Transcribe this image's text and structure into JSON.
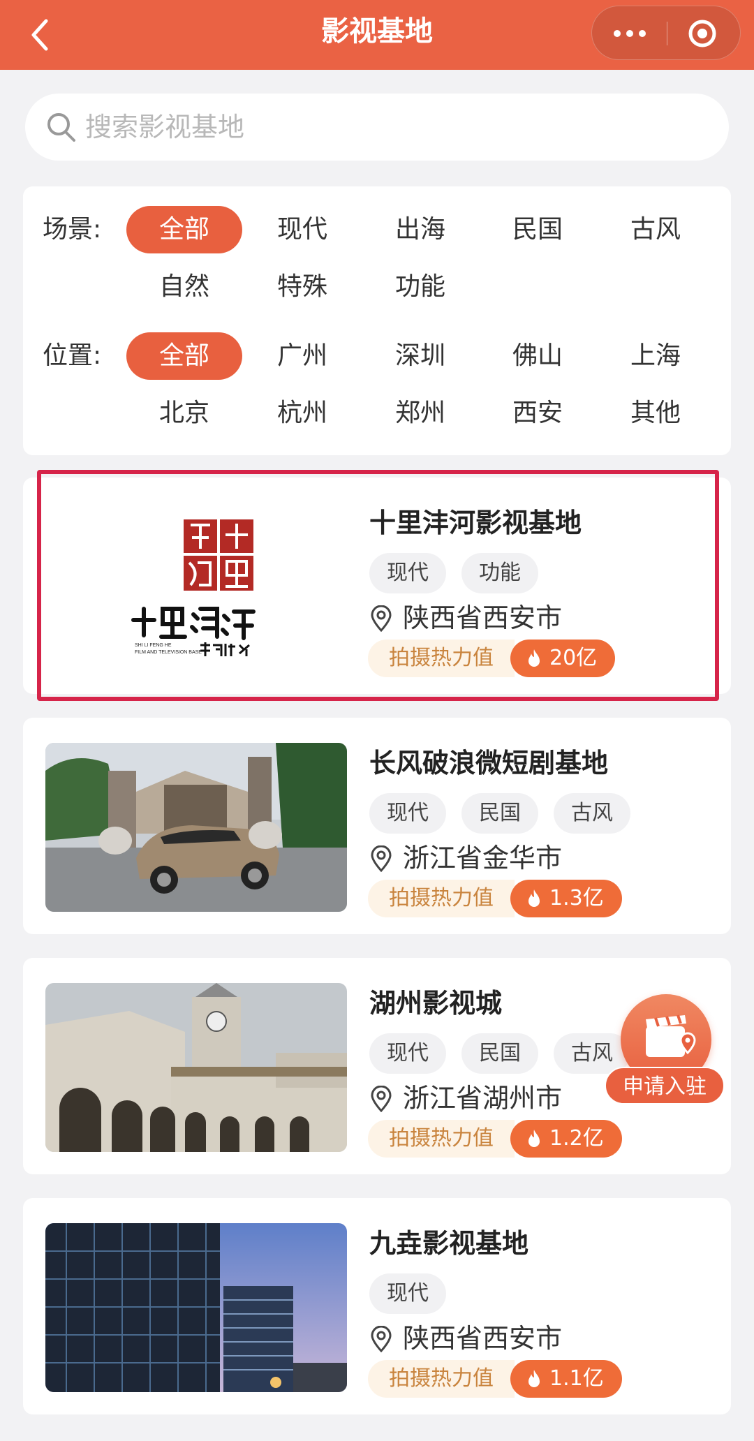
{
  "header": {
    "title": "影视基地"
  },
  "search": {
    "placeholder": "搜索影视基地"
  },
  "filters": {
    "scene": {
      "label": "场景:",
      "options": [
        "全部",
        "现代",
        "出海",
        "民国",
        "古风",
        "自然",
        "特殊",
        "功能"
      ],
      "selected": "全部"
    },
    "location": {
      "label": "位置:",
      "options": [
        "全部",
        "广州",
        "深圳",
        "佛山",
        "上海",
        "北京",
        "杭州",
        "郑州",
        "西安",
        "其他"
      ],
      "selected": "全部"
    }
  },
  "heat_label": "拍摄热力值",
  "cards": [
    {
      "title": "十里沣河影视基地",
      "tags": [
        "现代",
        "功能"
      ],
      "location": "陕西省西安市",
      "heat": "20亿",
      "logo": {
        "seal": "沣十河里",
        "name": "十里澧河",
        "en": "SHI LI FENG HE FILM AND TELEVISION BASE",
        "sub": "影视基地"
      }
    },
    {
      "title": "长风破浪微短剧基地",
      "tags": [
        "现代",
        "民国",
        "古风"
      ],
      "location": "浙江省金华市",
      "heat": "1.3亿"
    },
    {
      "title": "湖州影视城",
      "tags": [
        "现代",
        "民国",
        "古风"
      ],
      "location": "浙江省湖州市",
      "heat": "1.2亿"
    },
    {
      "title": "九垚影视基地",
      "tags": [
        "现代"
      ],
      "location": "陕西省西安市",
      "heat": "1.1亿"
    }
  ],
  "apply_button": {
    "label": "申请入驻"
  },
  "colors": {
    "primary": "#e8603f",
    "header": "#ea6244",
    "highlight": "#d62449"
  }
}
